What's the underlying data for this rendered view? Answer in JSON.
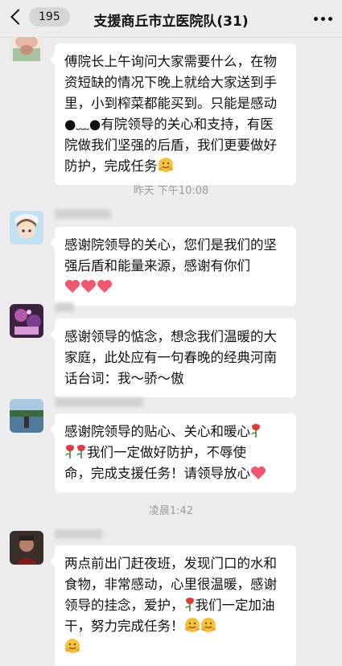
{
  "header": {
    "back_count": "195",
    "title": "支援商丘市立医院队(31)"
  },
  "timestamps": [
    "昨天 下午10:08",
    "凌晨1:42"
  ],
  "messages": [
    {
      "avatar": "avatar-anime-girl",
      "text": "傅院长上午询问大家需要什么，在物资短缺的情况下晚上就给大家送到手里，小到榨菜都能买到。只能是感动●﹏●有院领导的关心和支持，有医院做我们坚强的后盾，我们更要做好防护，完成任务"
    },
    {
      "avatar": "avatar-anime-boy",
      "text": "感谢院领导的关心，您们是我们的坚强后盾和能量来源，感谢有你们"
    },
    {
      "avatar": "avatar-purple-scene",
      "text": "感谢领导的惦念，想念我们温暖的大家庭，此处应有一句春晚的经典河南话台词：我～骄～傲"
    },
    {
      "avatar": "avatar-lake-scene",
      "line1": "感谢院领导的贴心、关心和暖心",
      "line2": "我们一定做好防护，不辱使",
      "line3": "命，完成支援任务！请领导放心"
    },
    {
      "avatar": "avatar-dark-portrait",
      "text1": "两点前出门赶夜班，发现门口的水和食物，非常感动，心里很温暖，感谢领导的挂念，爱护，",
      "text2": "我们一定加油干，努力完成任务！"
    }
  ],
  "colors": {
    "bubble": "#ffffff",
    "background": "#ededed",
    "heart": "#f0566e"
  }
}
